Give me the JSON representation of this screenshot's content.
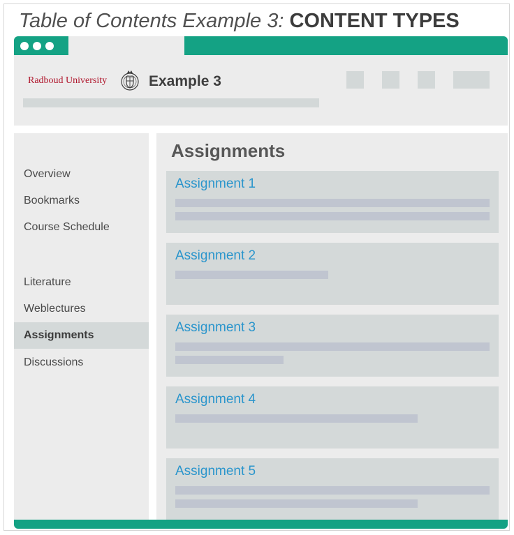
{
  "caption": {
    "prefix": "Table of Contents Example 3: ",
    "emphasis": "CONTENT TYPES"
  },
  "header": {
    "brand": "Radboud University",
    "course_title": "Example 3",
    "placeholder_buttons": 4
  },
  "sidebar": {
    "items": [
      {
        "label": "Overview",
        "active": false
      },
      {
        "label": "Bookmarks",
        "active": false
      },
      {
        "label": "Course Schedule",
        "active": false
      },
      {
        "label": "Literature",
        "active": false
      },
      {
        "label": "Weblectures",
        "active": false
      },
      {
        "label": "Assignments",
        "active": true
      },
      {
        "label": "Discussions",
        "active": false
      }
    ]
  },
  "main": {
    "title": "Assignments",
    "cards": [
      {
        "title": "Assignment 1"
      },
      {
        "title": "Assignment 2"
      },
      {
        "title": "Assignment 3"
      },
      {
        "title": "Assignment 4"
      },
      {
        "title": "Assignment 5"
      }
    ]
  },
  "colors": {
    "accent": "#14a284",
    "link": "#2a95cc",
    "brand": "#b0172d",
    "panel": "#ececec",
    "card": "#d4d9d9",
    "placeholder": "#c0c5d0"
  },
  "icons": [
    "window-dot-icon",
    "university-seal-icon"
  ]
}
